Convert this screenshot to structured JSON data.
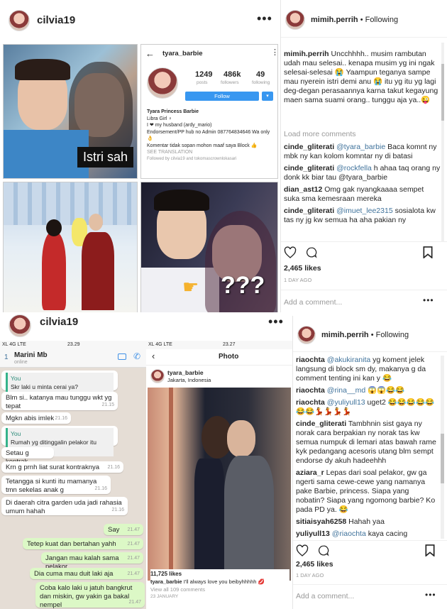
{
  "top_left": {
    "username": "cilvia19",
    "overlay_text": "Istri sah",
    "question": "???",
    "profile": {
      "username": "tyara_barbie",
      "posts": "1249",
      "posts_label": "posts",
      "followers": "486k",
      "followers_label": "followers",
      "following": "49",
      "following_label": "following",
      "follow_label": "Follow",
      "name": "Tyara Princess Barbie",
      "bio1": "Libra Girl ♀",
      "bio2": "I ❤ my husband (ardy_mario)",
      "bio3": "Endorsement/PP hub no Admin 087764834646 Wa only 👌",
      "bio4": "Komentar tidak sopan mohon maaf saya Block 👍",
      "see_translation": "SEE TRANSLATION",
      "followed_by": "Followed by cilvia19 and tokomascrownlokasari"
    }
  },
  "top_right": {
    "username": "mimih.perrih",
    "following": "• Following",
    "caption_user": "mimih.perrih",
    "caption": "Uncchhhh.. musim rambutan udah mau selesai.. kenapa musim yg ini ngak selesai-selesai 😭 Yaampun teganya sampe mau nyerein istri demi anu 😭 itu yg itu yg lagi deg-degan perasaannya karna takut kegayung maen sama suami orang.. tunggu aja ya..😜",
    "load_more": "Load more comments",
    "comments": [
      {
        "user": "cinde_gliterati",
        "mention": "@tyara_barbie",
        "text": " Baca komnt ny mbk ny kan kolom komntar ny di batasi"
      },
      {
        "user": "cinde_gliterati",
        "mention": "@rockfella",
        "text": " h ahaa taq orang ny donk kk biar tau @tyara_barbie"
      },
      {
        "user": "dian_ast12",
        "mention": "",
        "text": " Omg gak nyangkaaaa sempet suka sma kemesraan mereka"
      },
      {
        "user": "cinde_gliterati",
        "mention": "@imuet_lee2315",
        "text": " sosialota kw tas ny jg kw semua ha aha pakian ny"
      }
    ],
    "likes": "2,465 likes",
    "date": "1 DAY AGO",
    "add_comment": "Add a comment..."
  },
  "bottom_left": {
    "username": "cilvia19",
    "wa": {
      "carrier": "XL 4G LTE",
      "time": "23.29",
      "count": "1",
      "contact": "Marini Mb",
      "status": "online",
      "messages": [
        {
          "dir": "in",
          "fwd_name": "You",
          "fwd_text": "Skr laki u minta cerai ya?",
          "text": "",
          "time": ""
        },
        {
          "dir": "in",
          "text": "Blm si.. katanya mau tunggu wkt yg tepat",
          "time": "21.15"
        },
        {
          "dir": "in",
          "text": "Mgkn abis imlek",
          "time": "21.16"
        },
        {
          "dir": "in",
          "fwd_name": "You",
          "fwd_text": "Rumah yg ditinggalin pelakor itu beli?",
          "text": "",
          "time": ""
        },
        {
          "dir": "in",
          "text": "Setau g kontrak",
          "time": ""
        },
        {
          "dir": "in",
          "text": "Krn g prnh liat surat kontraknya",
          "time": "21.16"
        },
        {
          "dir": "in",
          "text": "Tetangga si kunti itu mamanya tmn sekelas anak g",
          "time": "21.16"
        },
        {
          "dir": "in",
          "text": "Di daerah citra garden uda jadi rahasia umum hahah",
          "time": "21.16"
        },
        {
          "dir": "out",
          "text": "Say",
          "time": "21.47"
        },
        {
          "dir": "out",
          "text": "Tetep kuat dan bertahan yahh",
          "time": "21.47"
        },
        {
          "dir": "out",
          "text": "Jangan mau kalah sama pelakor",
          "time": "21.47"
        },
        {
          "dir": "out",
          "text": "Dia cuma mau duit laki aja",
          "time": "21.47"
        },
        {
          "dir": "out",
          "text": "Coba kalo laki u jatuh bangkrut dan miskin, gw yakin ga bakal nempel",
          "time": "21.47"
        }
      ]
    },
    "ig": {
      "carrier": "XL 4G LTE",
      "time": "23.27",
      "title": "Photo",
      "username": "tyara_barbie",
      "location": "Jakarta, Indonesia",
      "likes": "11,725 likes",
      "caption_user": "tyara_barbie",
      "caption": " I'll always love you beibyhhhhh 💋",
      "view_all": "View all 109 comments",
      "date": "23 JANUARY"
    }
  },
  "bottom_right": {
    "username": "mimih.perrih",
    "following": "• Following",
    "comments": [
      {
        "user": "riaochta",
        "mention": "@akukiranita",
        "text": " yg koment jelek langsung di block sm dy, makanya g da comment tenting ini kan y 😂"
      },
      {
        "user": "riaochta",
        "mention": "@rina__md",
        "text": " 😱😱😂😂"
      },
      {
        "user": "riaochta",
        "mention": "@yuliyull13",
        "text": " uget2 😂😂😂😂😂😂😂💃💃💃💃"
      },
      {
        "user": "cinde_gliterati",
        "mention": "",
        "text": " Tambhnin sist gaya ny norak cara berpakian ny norak tas kw semua numpuk di lemari atas bawah rame kyk pedangang acesoris utang blm sempt endorse dy akuh hadeehhh"
      },
      {
        "user": "aziara_r",
        "mention": "",
        "text": " Lepas dari soal pelakor, gw ga ngerti sama cewe-cewe yang namanya pake Barbie, princess. Siapa yang nobatin? Siapa yang ngomong barbie? Ko pada PD ya. 😂"
      },
      {
        "user": "sitiaisyah6258",
        "mention": "",
        "text": " Hahah yaa"
      },
      {
        "user": "yuliyull13",
        "mention": "@riaochta",
        "text": " kaya cacing kepanasan eim 😂"
      }
    ],
    "likes": "2,465 likes",
    "date": "1 DAY AGO",
    "add_comment": "Add a comment..."
  }
}
